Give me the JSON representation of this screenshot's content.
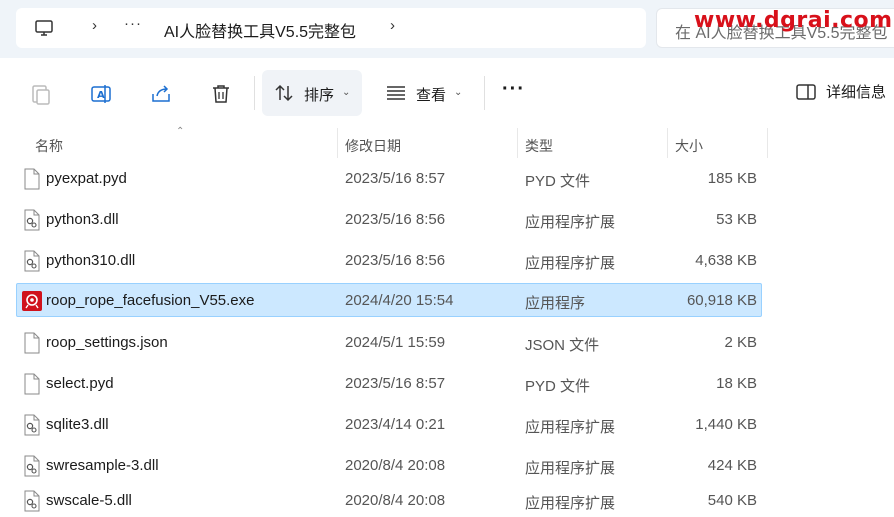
{
  "address": {
    "more_label": "···",
    "breadcrumb": "AI人脸替换工具V5.5完整包",
    "search_placeholder": "在 AI人脸替换工具V5.5完整包",
    "watermark": "www.dgrai.com"
  },
  "toolbar": {
    "sort_label": "排序",
    "view_label": "查看",
    "more_label": "···",
    "details_label": "详细信息"
  },
  "columns": {
    "name": "名称",
    "date": "修改日期",
    "type": "类型",
    "size": "大小"
  },
  "files": [
    {
      "name": "pyexpat.pyd",
      "date": "2023/5/16 8:57",
      "type": "PYD 文件",
      "size": "185 KB",
      "icon": "file-icon"
    },
    {
      "name": "python3.dll",
      "date": "2023/5/16 8:56",
      "type": "应用程序扩展",
      "size": "53 KB",
      "icon": "dll-icon"
    },
    {
      "name": "python310.dll",
      "date": "2023/5/16 8:56",
      "type": "应用程序扩展",
      "size": "4,638 KB",
      "icon": "dll-icon"
    },
    {
      "name": "roop_rope_facefusion_V55.exe",
      "date": "2024/4/20 15:54",
      "type": "应用程序",
      "size": "60,918 KB",
      "icon": "app-icon",
      "selected": true
    },
    {
      "name": "roop_settings.json",
      "date": "2024/5/1 15:59",
      "type": "JSON 文件",
      "size": "2 KB",
      "icon": "file-icon"
    },
    {
      "name": "select.pyd",
      "date": "2023/5/16 8:57",
      "type": "PYD 文件",
      "size": "18 KB",
      "icon": "file-icon"
    },
    {
      "name": "sqlite3.dll",
      "date": "2023/4/14 0:21",
      "type": "应用程序扩展",
      "size": "1,440 KB",
      "icon": "dll-icon"
    },
    {
      "name": "swresample-3.dll",
      "date": "2020/8/4 20:08",
      "type": "应用程序扩展",
      "size": "424 KB",
      "icon": "dll-icon"
    },
    {
      "name": "swscale-5.dll",
      "date": "2020/8/4 20:08",
      "type": "应用程序扩展",
      "size": "540 KB",
      "icon": "dll-icon"
    }
  ]
}
